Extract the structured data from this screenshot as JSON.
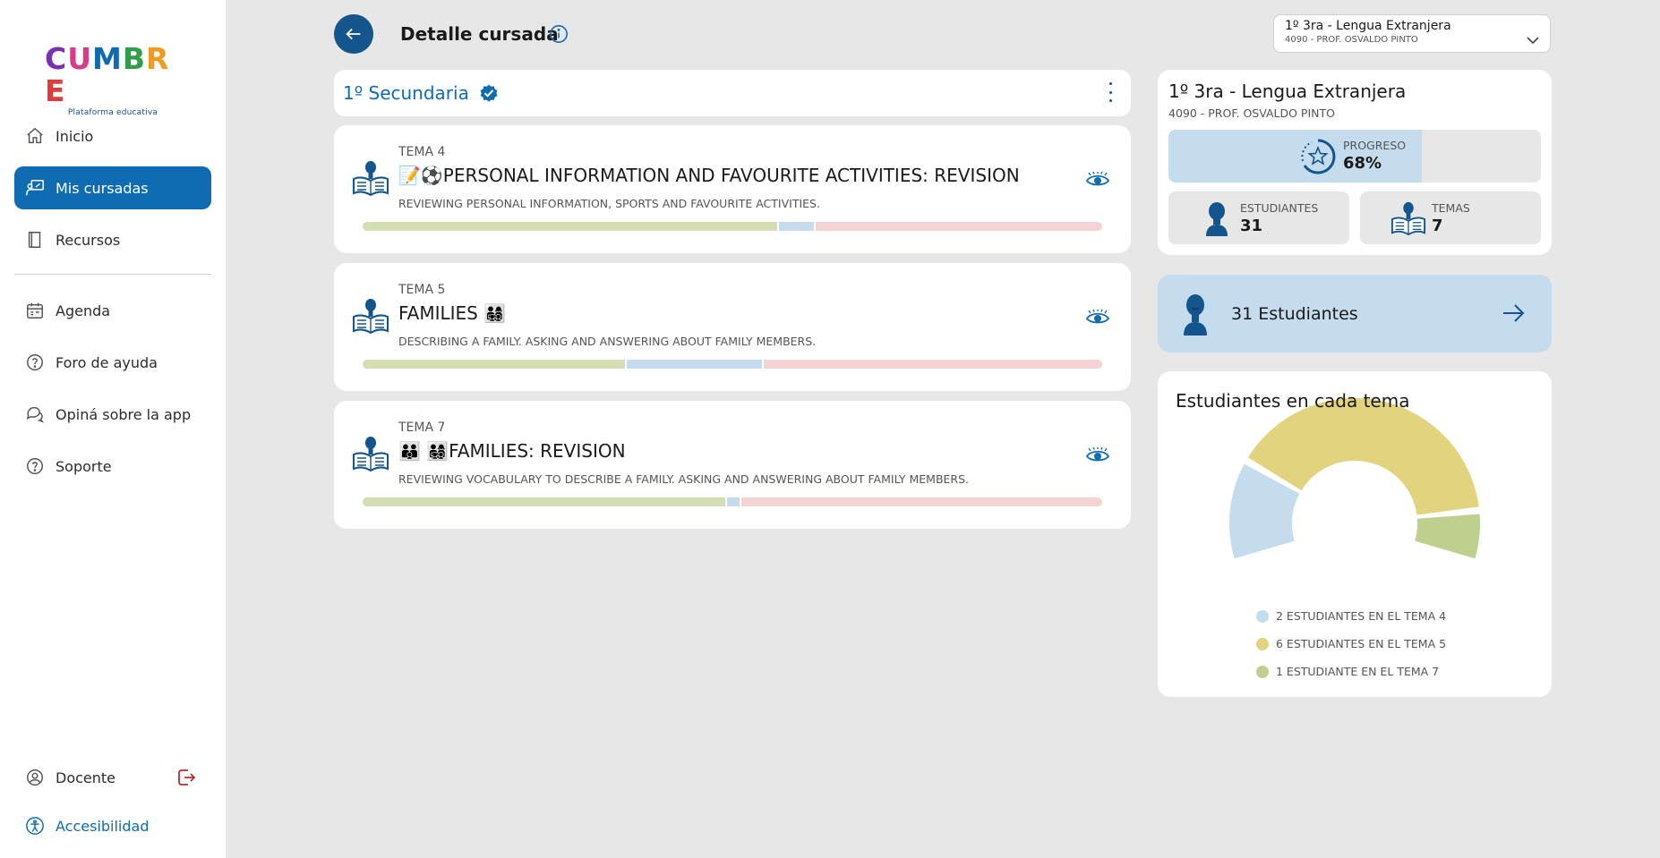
{
  "brand": {
    "letters": [
      "C",
      "U",
      "M",
      "B",
      "R",
      "E"
    ],
    "letter_colors": [
      "#7a2fb5",
      "#d93a8a",
      "#0f6cb2",
      "#2e9e4a",
      "#f29a1f",
      "#e23b3b"
    ],
    "tagline": "Plataforma educativa"
  },
  "sidebar": {
    "items": [
      {
        "label": "Inicio",
        "icon": "home-icon"
      },
      {
        "label": "Mis cursadas",
        "icon": "teacher-board-icon"
      },
      {
        "label": "Recursos",
        "icon": "book-icon"
      },
      {
        "label": "Agenda",
        "icon": "calendar-icon"
      },
      {
        "label": "Foro de ayuda",
        "icon": "help-circle-icon"
      },
      {
        "label": "Opiná sobre la app",
        "icon": "chat-bubbles-icon"
      },
      {
        "label": "Soporte",
        "icon": "help-circle-icon"
      }
    ],
    "user_label": "Docente",
    "accessibility_label": "Accesibilidad"
  },
  "header": {
    "title": "Detalle cursada",
    "select": {
      "main": "1º 3ra - Lengua Extranjera",
      "sub": "4090 - PROF. OSVALDO PINTO"
    }
  },
  "level": {
    "title": "1º Secundaria"
  },
  "temas": [
    {
      "label": "TEMA 4",
      "title": "📝⚽PERSONAL INFORMATION AND FAVOURITE ACTIVITIES: REVISION",
      "desc": "REVIEWING PERSONAL INFORMATION, SPORTS AND FAVOURITE ACTIVITIES.",
      "progress": {
        "green": 0.56,
        "blue": 0.05
      }
    },
    {
      "label": "TEMA 5",
      "title": "FAMILIES 👨‍👩‍👧‍👦",
      "desc": "DESCRIBING A FAMILY. ASKING AND ANSWERING ABOUT FAMILY MEMBERS.",
      "progress": {
        "green": 0.355,
        "blue": 0.185
      }
    },
    {
      "label": "TEMA 7",
      "title": "👪 👨‍👩‍👧‍👦FAMILIES: REVISION",
      "desc": "REVIEWING VOCABULARY TO DESCRIBE A FAMILY. ASKING AND ANSWERING ABOUT FAMILY MEMBERS.",
      "progress": {
        "green": 0.49,
        "blue": 0.02
      }
    }
  ],
  "course": {
    "title": "1º 3ra - Lengua Extranjera",
    "sub": "4090 - PROF. OSVALDO PINTO",
    "progress_label": "PROGRESO",
    "progress_value": "68%",
    "progress_fraction": 0.68,
    "students_label": "ESTUDIANTES",
    "students_value": "31",
    "temas_label": "TEMAS",
    "temas_value": "7"
  },
  "students_button": {
    "label": "31 Estudiantes"
  },
  "chart_data": {
    "type": "pie",
    "title": "Estudiantes en cada tema",
    "variant": "half-donut",
    "series": [
      {
        "name": "2 ESTUDIANTES EN EL TEMA 4",
        "value": 2,
        "color": "#c4dced"
      },
      {
        "name": "6 ESTUDIANTES EN EL TEMA 5",
        "value": 6,
        "color": "#e2d47f"
      },
      {
        "name": "1 ESTUDIANTE EN EL TEMA 7",
        "value": 1,
        "color": "#bfd08e"
      }
    ]
  },
  "colors": {
    "accent": "#0f6cb2",
    "dark_accent": "#13558c",
    "progress_green": "#d3dfb1",
    "progress_blue": "#c4dced",
    "progress_red": "#f6d3d3"
  }
}
